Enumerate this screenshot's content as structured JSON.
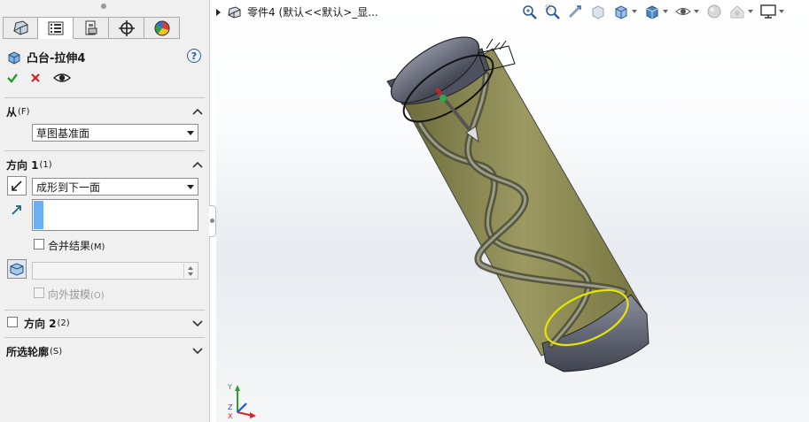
{
  "feature": {
    "title": "凸台-拉伸4",
    "help_label": "?"
  },
  "tabs": [
    {
      "name": "feature-manager"
    },
    {
      "name": "property-manager"
    },
    {
      "name": "configuration-manager"
    },
    {
      "name": "dimxpert-manager"
    },
    {
      "name": "display-manager"
    }
  ],
  "from": {
    "heading": "从",
    "heading_sub": "(F)",
    "selected": "草图基准面"
  },
  "direction1": {
    "heading": "方向 1",
    "heading_sub": "(1)",
    "end_condition": "成形到下一面",
    "merge_label": "合并结果",
    "merge_sub": "(M)",
    "merge_checked": false,
    "draft_label": "向外拔模",
    "draft_sub": "(O)"
  },
  "direction2": {
    "heading": "方向 2",
    "heading_sub": "(2)"
  },
  "contours": {
    "heading": "所选轮廓",
    "heading_sub": "(S)"
  },
  "viewport": {
    "crumb": "零件4  (默认<<默认>_显...",
    "triad_x": "X",
    "triad_y": "Y",
    "triad_z": "Z"
  },
  "colors": {
    "accept": "#2a9a2a",
    "cancel": "#d02020",
    "cylinder_fill": "#8a8a55",
    "cap": "#5c6070",
    "highlight": "#e6e600"
  }
}
